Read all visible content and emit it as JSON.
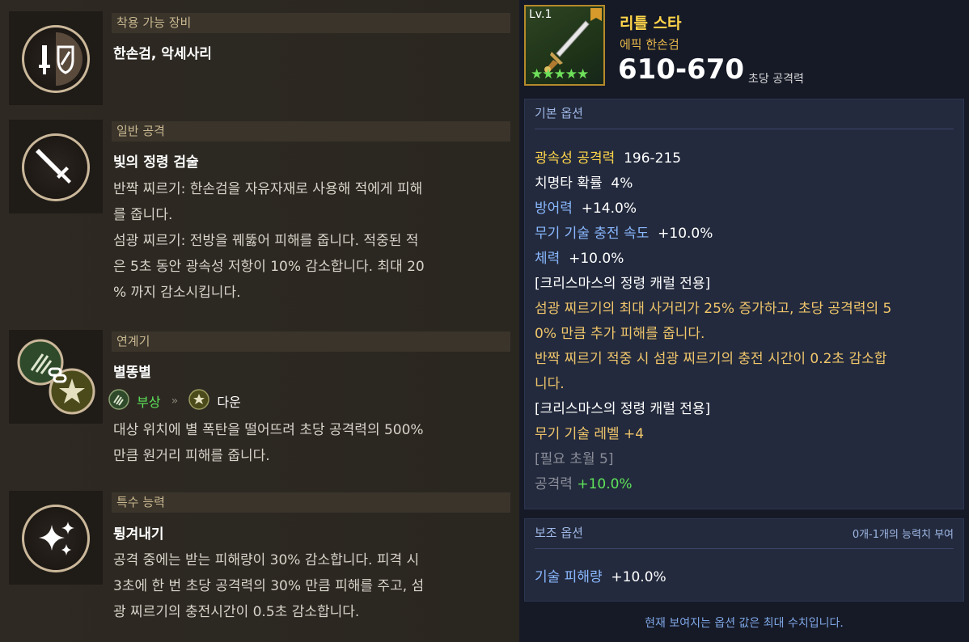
{
  "sections": {
    "equip": {
      "header": "착용 가능 장비",
      "title": "한손검, 악세사리"
    },
    "normal": {
      "header": "일반 공격",
      "title": "빛의 정령 검술",
      "lines": [
        "반짝 찌르기: 한손검을 자유자재로 사용해 적에게 피해",
        "를 줍니다.",
        "섬광 찌르기: 전방을 꿰뚫어 피해를 줍니다. 적중된 적",
        "은 5초 동안 광속성 저항이 10% 감소합니다. 최대 20",
        "% 까지 감소시킵니다."
      ]
    },
    "combo": {
      "header": "연계기",
      "title": "별똥별",
      "from": "부상",
      "to": "다운",
      "lines": [
        "대상 위치에 별 폭탄을 떨어뜨려 초당 공격력의 500%",
        "만큼 원거리 피해를 줍니다."
      ]
    },
    "special": {
      "header": "특수 능력",
      "title": "튕겨내기",
      "lines": [
        "공격 중에는 받는 피해량이 30% 감소합니다. 피격 시",
        "3초에 한 번 초당 공격력의 30% 만큼 피해를 주고, 섬",
        "광 찌르기의 충전시간이 0.5초 감소합니다."
      ]
    }
  },
  "item": {
    "level": "Lv.1",
    "stars": "★★★★★",
    "name": "리틀 스타",
    "type": "에픽 한손검",
    "damage": "610-670",
    "damage_label": "초당 공격력"
  },
  "base_options": {
    "header": "기본 옵션",
    "rows": [
      {
        "k": "광속성 공격력",
        "v": "196-215"
      },
      {
        "k": "치명타 확률",
        "v": "4%"
      },
      {
        "k": "방어력",
        "v": "+14.0%"
      },
      {
        "k": "무기 기술 충전 속도",
        "v": "+10.0%"
      },
      {
        "k": "체력",
        "v": "+10.0%"
      }
    ],
    "bond1_title": "[크리스마스의 정령 캐럴 전용]",
    "bond1_lines": [
      "섬광 찌르기의 최대 사거리가 25% 증가하고, 초당 공격력의 5",
      "0% 만큼 추가 피해를 줍니다.",
      "반짝 찌르기 적중 시 섬광 찌르기의 충전 시간이 0.2초 감소합",
      "니다."
    ],
    "bond2_title": "[크리스마스의 정령 캐럴 전용]",
    "weapon_skill": "무기 기술 레벨 +4",
    "requirement": "[필요 초월 5]",
    "atk_k": "공격력",
    "atk_v": "+10.0%"
  },
  "sub_options": {
    "header": "보조 옵션",
    "note": "0개-1개의 능력치 부여",
    "k": "기술 피해량",
    "v": "+10.0%"
  },
  "footer": "현재 보여지는 옵션 값은 최대 수치입니다.",
  "icons": [
    "sword-shield-icon",
    "sword-icon",
    "claw-icon",
    "chain-icon",
    "star-burst-icon",
    "sparkle-icon",
    "double-chevron-icon"
  ],
  "colors": {
    "epic": "#e5b54a",
    "name": "#ffd54a",
    "green": "#5ee35a",
    "accent_blue": "#8ab8ff"
  }
}
